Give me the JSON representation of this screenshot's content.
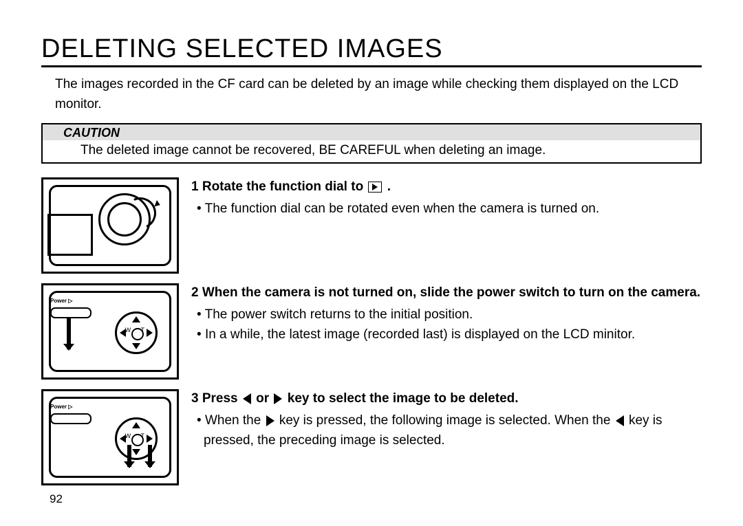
{
  "title": "DELETING SELECTED IMAGES",
  "intro": "The images recorded in the CF card can be deleted by an image while checking them displayed on the LCD monitor.",
  "caution": {
    "label": "CAUTION",
    "text": "The deleted image cannot be recovered, BE CAREFUL when deleting an image."
  },
  "steps": [
    {
      "num": "1",
      "head_pre": "Rotate the function dial to ",
      "head_post": " .",
      "bullets": [
        "The function dial can be rotated even when the camera is turned on."
      ]
    },
    {
      "num": "2",
      "head_pre": "When the camera is not turned on, slide the power switch to turn on the camera.",
      "head_post": "",
      "bullets": [
        "The power switch returns to the initial position.",
        "In a while, the latest image (recorded last) is displayed on the LCD minitor."
      ]
    },
    {
      "num": "3",
      "head_pre": "Press ",
      "head_mid": " or ",
      "head_post": " key to select the image to be deleted.",
      "bullets_pre": "When the ",
      "bullets_mid": " key is pressed, the following image is selected. When the ",
      "bullets_post": " key is pressed, the preceding image is selected."
    }
  ],
  "page_number": "92"
}
